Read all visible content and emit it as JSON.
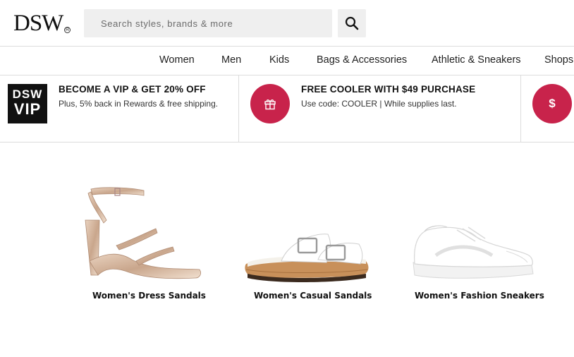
{
  "header": {
    "logo_text": "DSW",
    "logo_reg": "R",
    "search_placeholder": "Search styles, brands & more",
    "search_icon": "search-icon"
  },
  "nav": {
    "items": [
      "Women",
      "Men",
      "Kids",
      "Bags & Accessories",
      "Athletic & Sneakers",
      "Shops"
    ]
  },
  "promos": [
    {
      "badge_line1": "DSW",
      "badge_line2": "VIP",
      "title": "BECOME A VIP & GET 20% OFF",
      "subtitle": "Plus, 5% back in Rewards & free shipping."
    },
    {
      "icon": "gift-icon",
      "title": "FREE COOLER WITH $49 PURCHASE",
      "subtitle": "Use code: COOLER | While supplies last."
    },
    {
      "icon": "dollar-icon",
      "icon_text": "$"
    }
  ],
  "products": [
    {
      "label": "Women's Dress Sandals",
      "image": "dress-sandal-image"
    },
    {
      "label": "Women's Casual Sandals",
      "image": "casual-sandal-image"
    },
    {
      "label": "Women's Fashion Sneakers",
      "image": "fashion-sneaker-image"
    }
  ],
  "colors": {
    "accent": "#c8234b",
    "search_bg": "#efefef",
    "divider": "#dcdcdc"
  }
}
